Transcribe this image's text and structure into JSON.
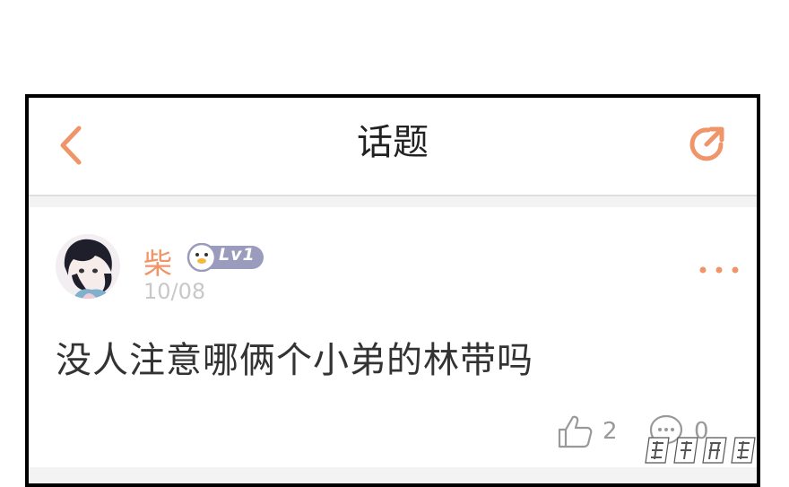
{
  "header": {
    "title": "话题",
    "back_icon": "chevron-left-icon",
    "share_icon": "share-arrow-icon",
    "accent_color": "#f0956a"
  },
  "post": {
    "username": "柴",
    "level": "Lv1",
    "date": "10/08",
    "content": "没人注意哪俩个小弟的林带吗",
    "likes": "2",
    "comments": "0",
    "more_icon": "more-dots-icon"
  }
}
